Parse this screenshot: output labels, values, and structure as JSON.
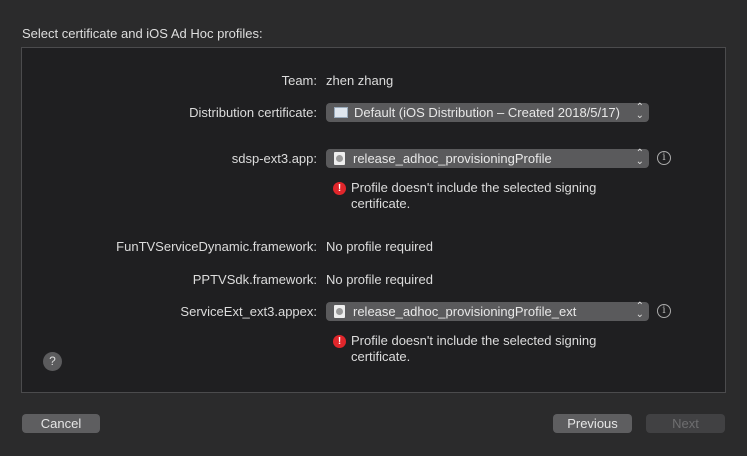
{
  "title": "Select certificate and iOS Ad Hoc profiles:",
  "team": {
    "label": "Team:",
    "value": "zhen zhang"
  },
  "certificate": {
    "label": "Distribution certificate:",
    "value": "Default (iOS Distribution – Created 2018/5/17)"
  },
  "items": [
    {
      "label": "sdsp-ext3.app:",
      "profile": "release_adhoc_provisioningProfile",
      "error_line1": "Profile doesn't include the selected signing",
      "error_line2": "certificate."
    },
    {
      "label": "FunTVServiceDynamic.framework:",
      "value": "No profile required"
    },
    {
      "label": "PPTVSdk.framework:",
      "value": "No profile required"
    },
    {
      "label": "ServiceExt_ext3.appex:",
      "profile": "release_adhoc_provisioningProfile_ext",
      "error_line1": "Profile doesn't include the selected signing",
      "error_line2": "certificate."
    }
  ],
  "help": "?",
  "info": "i",
  "error_glyph": "!",
  "chevrons": "⌃⌄",
  "buttons": {
    "cancel": "Cancel",
    "previous": "Previous",
    "next": "Next"
  }
}
